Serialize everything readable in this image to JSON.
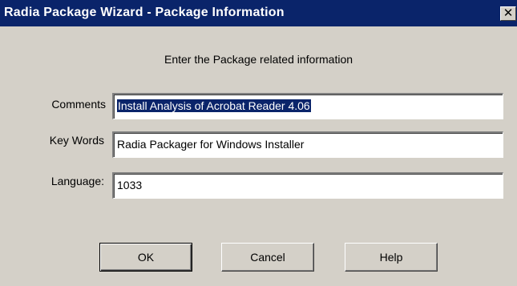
{
  "window": {
    "title": "Radia Package Wizard - Package Information",
    "close_glyph": "✕"
  },
  "heading": "Enter the Package related information",
  "fields": {
    "comments": {
      "label": "Comments",
      "value": "Install Analysis of Acrobat Reader 4.06"
    },
    "keywords": {
      "label": "Key Words",
      "value": "Radia Packager for Windows Installer"
    },
    "language": {
      "label": "Language:",
      "value": "1033"
    }
  },
  "buttons": {
    "ok": "OK",
    "cancel": "Cancel",
    "help": "Help"
  },
  "colors": {
    "titlebar": "#0a246a",
    "dialog_face": "#d4d0c8",
    "selection": "#0a246a"
  }
}
